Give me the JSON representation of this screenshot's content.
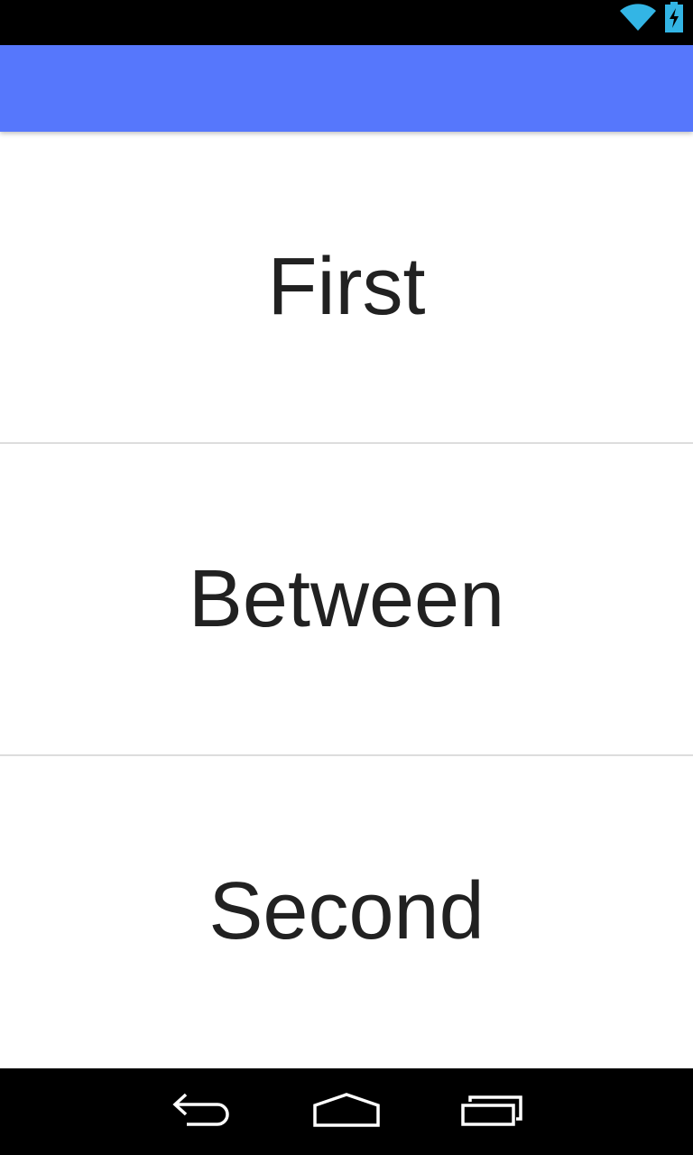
{
  "status_bar": {
    "icons": [
      "wifi-icon",
      "battery-charging-icon"
    ],
    "icon_color": "#33b5e5"
  },
  "app_bar": {
    "color": "#5677fc"
  },
  "list": {
    "items": [
      {
        "label": "First"
      },
      {
        "label": "Between"
      },
      {
        "label": "Second"
      }
    ]
  },
  "nav_bar": {
    "buttons": [
      "back-icon",
      "home-icon",
      "recents-icon"
    ]
  }
}
